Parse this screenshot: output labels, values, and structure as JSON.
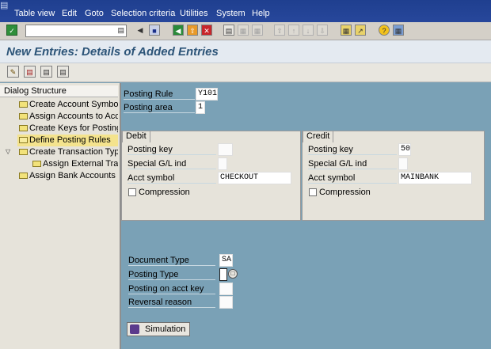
{
  "menu": [
    "Table view",
    "Edit",
    "Goto",
    "Selection criteria",
    "Utilities",
    "System",
    "Help"
  ],
  "command_field": {
    "value": ""
  },
  "title": "New Entries: Details of Added Entries",
  "dialog_structure": {
    "heading": "Dialog Structure",
    "items": [
      "Create Account Symbols",
      "Assign Accounts to Acco",
      "Create Keys for Posting I",
      "Define Posting Rules",
      "Create Transaction Type",
      "Assign External Tran",
      "Assign Bank Accounts to"
    ]
  },
  "posting_rule": {
    "label": "Posting Rule",
    "value": "Y101"
  },
  "posting_area": {
    "label": "Posting area",
    "value": "1"
  },
  "debit": {
    "title": "Debit",
    "posting_key_label": "Posting key",
    "posting_key": "",
    "special_gl_label": "Special G/L ind",
    "special_gl": "",
    "acct_symbol_label": "Acct symbol",
    "acct_symbol": "CHECKOUT",
    "compression_label": "Compression"
  },
  "credit": {
    "title": "Credit",
    "posting_key_label": "Posting key",
    "posting_key": "50",
    "special_gl_label": "Special G/L ind",
    "special_gl": "",
    "acct_symbol_label": "Acct symbol",
    "acct_symbol": "MAINBANK",
    "compression_label": "Compression"
  },
  "document_type": {
    "label": "Document Type",
    "value": "SA"
  },
  "posting_type": {
    "label": "Posting Type",
    "value": ""
  },
  "posting_on_acct_key": {
    "label": "Posting on acct key",
    "value": ""
  },
  "reversal_reason": {
    "label": "Reversal reason",
    "value": ""
  },
  "simulation_label": "Simulation"
}
